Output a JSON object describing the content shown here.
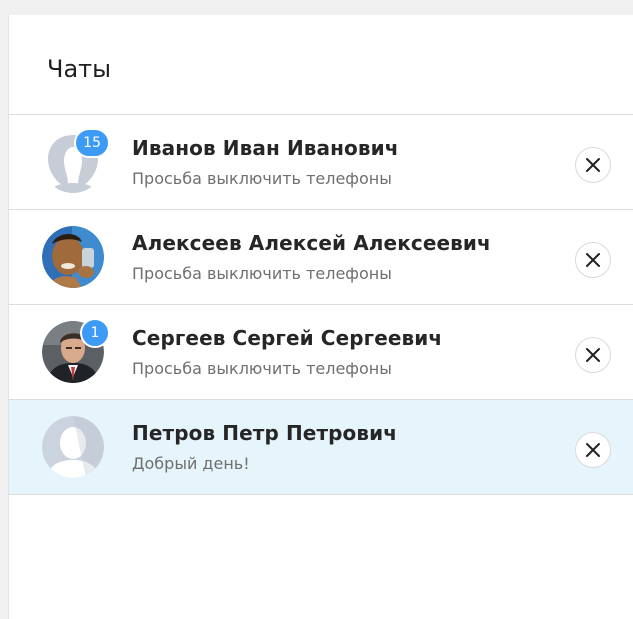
{
  "header": {
    "title": "Чаты"
  },
  "chats": [
    {
      "name": "Иванов Иван Иванович",
      "preview": "Просьба выключить телефоны",
      "unread": "15",
      "avatar": "default-avatar",
      "active": false
    },
    {
      "name": "Алексеев Алексей Алексеевич",
      "preview": "Просьба выключить телефоны",
      "unread": "",
      "avatar": "photo-avatar",
      "active": false
    },
    {
      "name": "Сергеев Сергей Сергеевич",
      "preview": "Просьба выключить телефоны",
      "unread": "1",
      "avatar": "photo-avatar",
      "active": false
    },
    {
      "name": "Петров Петр Петрович",
      "preview": "Добрый день!",
      "unread": "",
      "avatar": "default-avatar",
      "active": true
    }
  ],
  "icons": {
    "close": "close-icon"
  },
  "colors": {
    "accent": "#3d9bf5",
    "active_row": "#e6f4fc"
  }
}
